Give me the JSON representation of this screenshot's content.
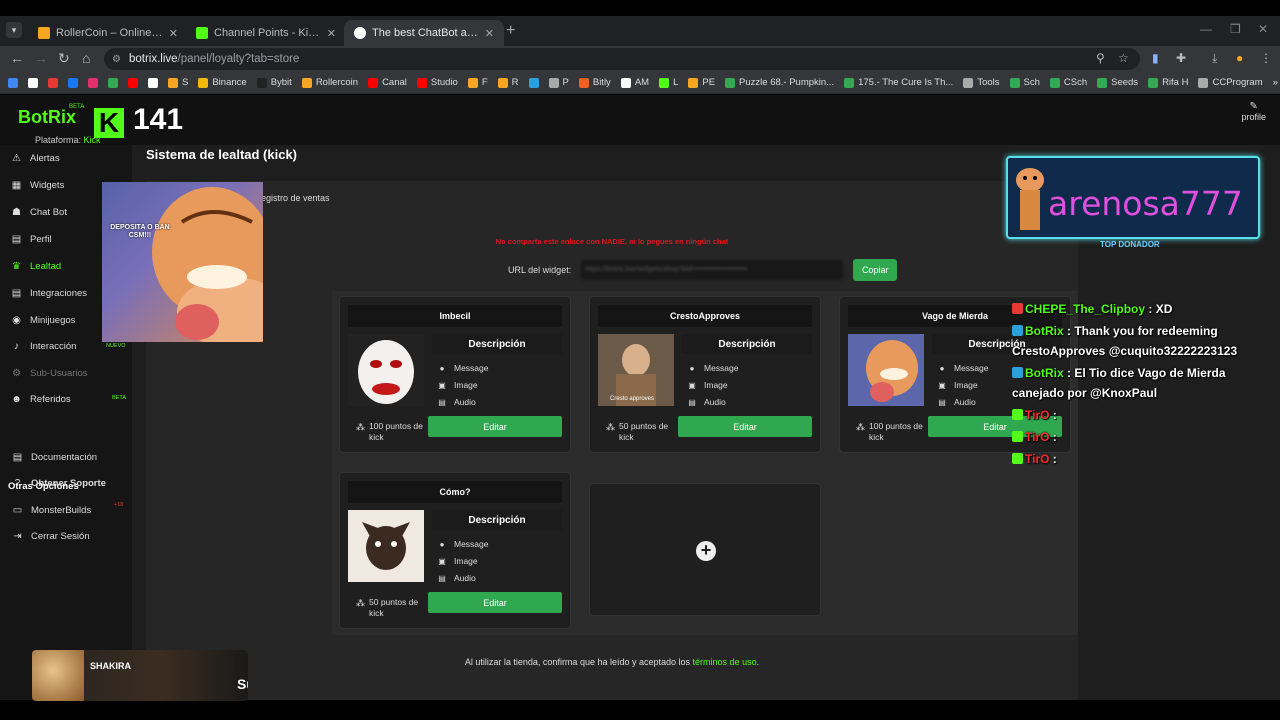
{
  "browser": {
    "tabs": [
      {
        "title": "RollerCoin – Online Bitcoin Mining",
        "color": "#f5a623",
        "active": false
      },
      {
        "title": "Channel Points - Kick Dashboard",
        "color": "#53fc18",
        "active": false
      },
      {
        "title": "The best ChatBot and Widgets",
        "color": "#ffffff",
        "active": true
      }
    ],
    "url_host": "botrix.live",
    "url_path": "/panel/loyalty?tab=store",
    "bookmarks": [
      {
        "label": "",
        "color": "#4285f4"
      },
      {
        "label": "",
        "color": "#ffffff"
      },
      {
        "label": "",
        "color": "#e53935"
      },
      {
        "label": "",
        "color": "#1877f2"
      },
      {
        "label": "",
        "color": "#e1306c"
      },
      {
        "label": "",
        "color": "#34a853"
      },
      {
        "label": "",
        "color": "#ff0000"
      },
      {
        "label": "",
        "color": "#ffffff"
      },
      {
        "label": "S",
        "color": "#f5a623"
      },
      {
        "label": "Binance",
        "color": "#f0b90b"
      },
      {
        "label": "Bybit",
        "color": "#222222"
      },
      {
        "label": "Rollercoin",
        "color": "#f5a623"
      },
      {
        "label": "Canal",
        "color": "#ff0000"
      },
      {
        "label": "Studio",
        "color": "#ff0000"
      },
      {
        "label": "F",
        "color": "#f5a623"
      },
      {
        "label": "R",
        "color": "#f5a623"
      },
      {
        "label": "",
        "color": "#2aa1da"
      },
      {
        "label": "P",
        "color": "#aaaaaa"
      },
      {
        "label": "Bitly",
        "color": "#ee6123"
      },
      {
        "label": "AM",
        "color": "#ffffff"
      },
      {
        "label": "L",
        "color": "#53fc18"
      },
      {
        "label": "PE",
        "color": "#f5a623"
      },
      {
        "label": "Puzzle 68.- Pumpkin...",
        "color": "#34a853"
      },
      {
        "label": "175.- The Cure Is Th...",
        "color": "#34a853"
      },
      {
        "label": "Tools",
        "color": "#aaaaaa"
      },
      {
        "label": "Sch",
        "color": "#34a853"
      },
      {
        "label": "CSch",
        "color": "#34a853"
      },
      {
        "label": "Seeds",
        "color": "#34a853"
      },
      {
        "label": "Rifa H",
        "color": "#34a853"
      },
      {
        "label": "CCProgram",
        "color": "#aaaaaa"
      }
    ]
  },
  "app": {
    "brand": "BotRix",
    "brand_badge": "BETA",
    "platform_label": "Plataforma:",
    "platform_value": "Kick",
    "profile_label": "profile",
    "viewer_count": "141",
    "kick_logo": "K"
  },
  "sidebar": {
    "items": [
      {
        "label": "Alertas",
        "icon": "⚠",
        "state": "normal",
        "tag": ""
      },
      {
        "label": "Widgets",
        "icon": "▦",
        "state": "normal",
        "tag": ""
      },
      {
        "label": "Chat Bot",
        "icon": "☗",
        "state": "normal",
        "tag": ""
      },
      {
        "label": "Perfil",
        "icon": "▤",
        "state": "normal",
        "tag": ""
      },
      {
        "label": "Lealtad",
        "icon": "♛",
        "state": "active",
        "tag": ""
      },
      {
        "label": "Integraciones",
        "icon": "▤",
        "state": "normal",
        "tag": ""
      },
      {
        "label": "Minijuegos",
        "icon": "◉",
        "state": "normal",
        "tag": ""
      },
      {
        "label": "Interacción",
        "icon": "♪",
        "state": "normal",
        "tag": ""
      },
      {
        "label": "Sub-Usuarios",
        "icon": "⚙",
        "state": "disabled",
        "tag": ""
      },
      {
        "label": "Referidos",
        "icon": "☻",
        "state": "normal",
        "tag": "BETA"
      }
    ],
    "other_heading": "Otras Opciones",
    "other_items": [
      {
        "label": "Documentación",
        "icon": "▤",
        "tag": ""
      },
      {
        "label": "Obtener Soporte",
        "icon": "?",
        "tag": ""
      },
      {
        "label": "MonsterBuilds",
        "icon": "▭",
        "tag": "+18"
      },
      {
        "label": "Cerrar Sesión",
        "icon": "⇥",
        "tag": ""
      }
    ],
    "new_badge": "NUEVO"
  },
  "main": {
    "title": "Sistema de lealtad (kick)",
    "subtab": "egistro de ventas",
    "warning": "No comparta este enlace con NADIE, ni lo pegues en ningún chat",
    "url_label": "URL del widget:",
    "url_value": "https://botrix.live/widgets/shop?bid=•••••••••••••••••••••",
    "copy_label": "Copiar",
    "description_label": "Descripción",
    "features": [
      "Message",
      "Image",
      "Audio"
    ],
    "edit_label": "Editar",
    "rewards": [
      {
        "name": "Imbecil",
        "cost": "100 puntos de kick"
      },
      {
        "name": "CrestoApproves",
        "cost": "50 puntos de kick",
        "image_caption": "Cresto approves"
      },
      {
        "name": "Vago de Mierda",
        "cost": "100 puntos de kick"
      },
      {
        "name": "Cómo?",
        "cost": "50 puntos de kick"
      }
    ],
    "add_icon": "+",
    "footer_text": "Al utilizar la tienda, confirma que ha leído y aceptado los",
    "footer_link": "términos de uso",
    "footer_end": "."
  },
  "overlays": {
    "meme_text": "DEPOSITA O BAN CSM!!!",
    "top_donor_name": "arenosa777",
    "top_donor_label": "TOP DONADOR",
    "chat": [
      {
        "user": "CHEPE_The_Clipboy",
        "sep": " : ",
        "text": "XD",
        "user_color": "#53fc18",
        "badge": "#e53935"
      },
      {
        "user": "BotRix",
        "sep": " : ",
        "text": "Thank you for redeeming CrestoApproves @cuquito32222223123",
        "user_color": "#53fc18",
        "badge": "#2aa1da"
      },
      {
        "user": "BotRix",
        "sep": " : ",
        "text": "El Tio dice Vago de Mierda canejado por @KnoxPaul",
        "user_color": "#53fc18",
        "badge": "#2aa1da"
      },
      {
        "user": "TirO",
        "sep": " :",
        "text": "",
        "user_color": "#ff2a2a",
        "badge": "#53fc18"
      },
      {
        "user": "TirO",
        "sep": " :",
        "text": "",
        "user_color": "#ff2a2a",
        "badge": "#53fc18"
      },
      {
        "user": "TirO",
        "sep": " :",
        "text": "",
        "user_color": "#ff2a2a",
        "badge": "#53fc18"
      }
    ],
    "music_artist": "SHAKIRA",
    "music_title": "Su"
  }
}
